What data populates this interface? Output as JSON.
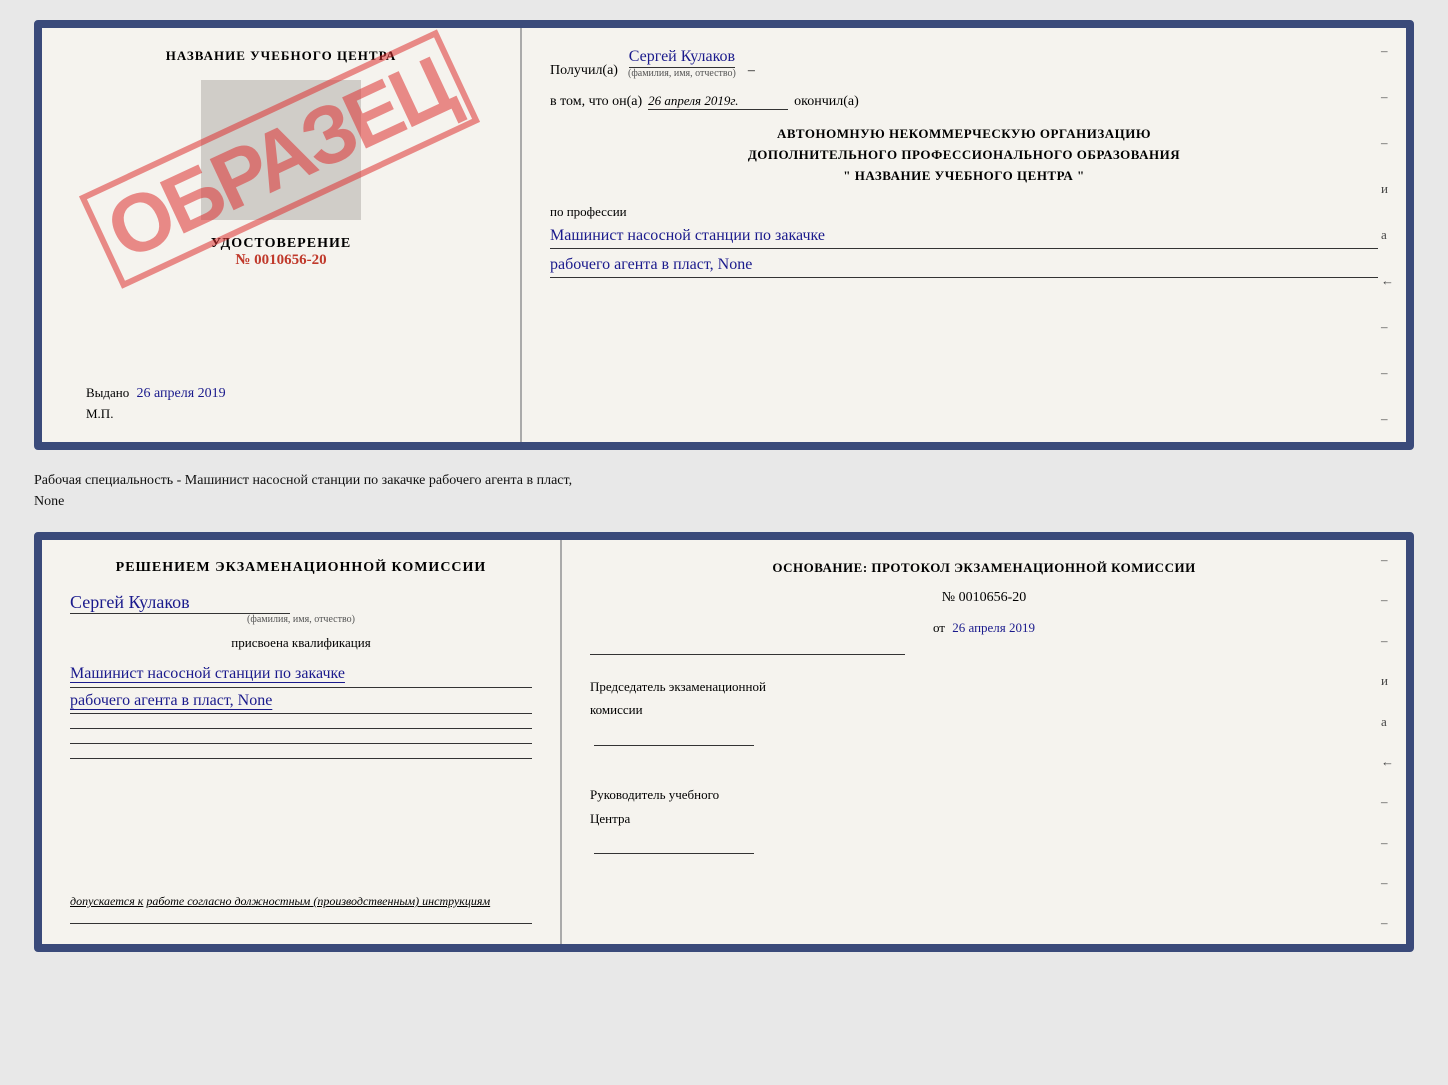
{
  "top_doc": {
    "left": {
      "institution_title": "НАЗВАНИЕ УЧЕБНОГО ЦЕНТРА",
      "udostoverenie_label": "УДОСТОВЕРЕНИЕ",
      "number": "№ 0010656-20",
      "vydano_label": "Выдано",
      "vydano_date": "26 апреля 2019",
      "mp_label": "М.П.",
      "obrazec": "ОБРАЗЕЦ"
    },
    "right": {
      "poluchil_label": "Получил(а)",
      "person_name": "Сергей Кулаков",
      "fio_hint": "(фамилия, имя, отчество)",
      "vtom_label": "в том, что он(а)",
      "date_value": "26 апреля 2019г.",
      "okonchil_label": "окончил(а)",
      "org_line1": "АВТОНОМНУЮ НЕКОММЕРЧЕСКУЮ ОРГАНИЗАЦИЮ",
      "org_line2": "ДОПОЛНИТЕЛЬНОГО ПРОФЕССИОНАЛЬНОГО ОБРАЗОВАНИЯ",
      "org_line3": "\" НАЗВАНИЕ УЧЕБНОГО ЦЕНТРА \"",
      "po_professii_label": "по профессии",
      "profession_line1": "Машинист насосной станции по закачке",
      "profession_line2": "рабочего агента в пласт, None",
      "right_dashes": [
        "-",
        "-",
        "-",
        "-",
        "и",
        "а",
        "←",
        "-",
        "-",
        "-",
        "-",
        "-"
      ]
    }
  },
  "caption": {
    "text": "Рабочая специальность - Машинист насосной станции по закачке рабочего агента в пласт,",
    "text2": "None"
  },
  "bottom_doc": {
    "left": {
      "decision_label": "Решением экзаменационной комиссии",
      "person_name": "Сергей Кулаков",
      "fio_hint": "(фамилия, имя, отчество)",
      "prisvoena_label": "присвоена квалификация",
      "qualification_line1": "Машинист насосной станции по закачке",
      "qualification_line2": "рабочего агента в пласт, None",
      "dopuskaetsya_label": "допускается к",
      "dopuskaetsya_value": "работе согласно должностным (производственным) инструкциям"
    },
    "right": {
      "osnovanie_label": "Основание: протокол экзаменационной комиссии",
      "number": "№ 0010656-20",
      "ot_label": "от",
      "date_value": "26 апреля 2019",
      "predsedatel_label": "Председатель экзаменационной",
      "komissii_label": "комиссии",
      "rukovoditel_label": "Руководитель учебного",
      "centra_label": "Центра",
      "right_dashes": [
        "-",
        "-",
        "-",
        "-",
        "-",
        "и",
        "а",
        "←",
        "-",
        "-",
        "-",
        "-",
        "-",
        "-"
      ]
    }
  }
}
